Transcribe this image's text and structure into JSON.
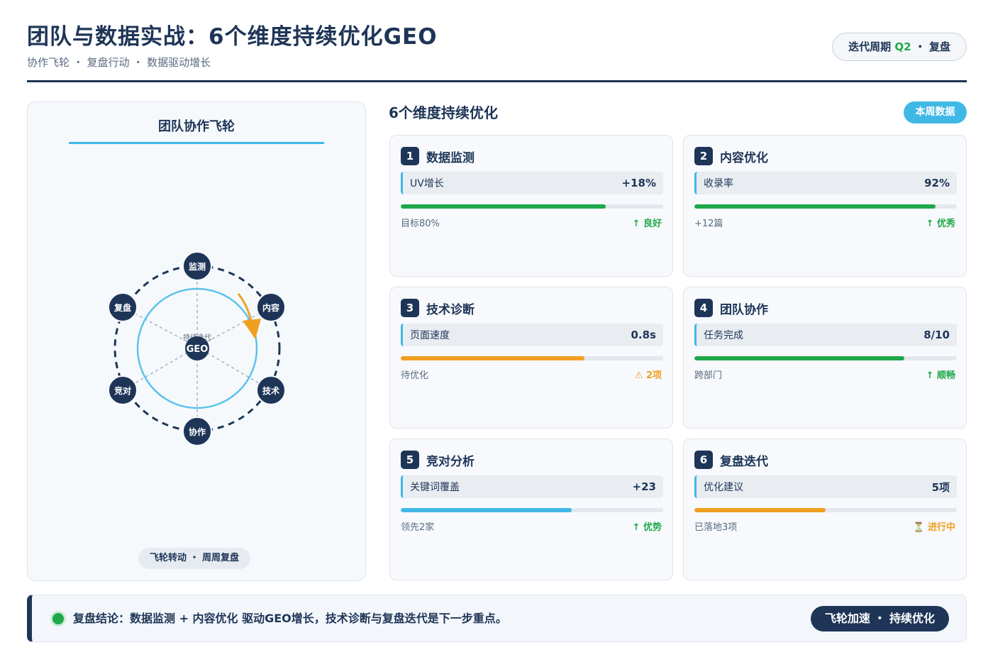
{
  "header": {
    "title": "团队与数据实战：6个维度持续优化GEO",
    "subtitle": "协作飞轮 ・ 复盘行动 ・ 数据驱动增长",
    "cycle_prefix": "迭代周期",
    "cycle_quarter": "Q2",
    "cycle_suffix": "・ 复盘"
  },
  "flywheel": {
    "title": "团队协作飞轮",
    "center_label": "GEO",
    "center_caption": "持续迭代",
    "nodes": [
      "监测",
      "内容",
      "技术",
      "协作",
      "竞对",
      "复盘"
    ],
    "footer": "飞轮转动 ・ 周周复盘"
  },
  "section": {
    "title": "6个维度持续优化",
    "badge": "本周数据"
  },
  "cards": [
    {
      "num": "1",
      "name": "数据监测",
      "metric_label": "UV增长",
      "metric_value": "+18%",
      "progress": 0.78,
      "bar_color": "#1ea84a",
      "foot_left": "目标80%",
      "foot_right": "↑ 良好",
      "status": "good"
    },
    {
      "num": "2",
      "name": "内容优化",
      "metric_label": "收录率",
      "metric_value": "92%",
      "progress": 0.92,
      "bar_color": "#1ea84a",
      "foot_left": "+12篇",
      "foot_right": "↑ 优秀",
      "status": "good"
    },
    {
      "num": "3",
      "name": "技术诊断",
      "metric_label": "页面速度",
      "metric_value": "0.8s",
      "progress": 0.7,
      "bar_color": "#f0a020",
      "foot_left": "待优化",
      "foot_right": "⚠ 2项",
      "status": "warn"
    },
    {
      "num": "4",
      "name": "团队协作",
      "metric_label": "任务完成",
      "metric_value": "8/10",
      "progress": 0.8,
      "bar_color": "#1ea84a",
      "foot_left": "跨部门",
      "foot_right": "↑ 顺畅",
      "status": "good"
    },
    {
      "num": "5",
      "name": "竞对分析",
      "metric_label": "关键词覆盖",
      "metric_value": "+23",
      "progress": 0.65,
      "bar_color": "#3fb8e6",
      "foot_left": "领先2家",
      "foot_right": "↑ 优势",
      "status": "good"
    },
    {
      "num": "6",
      "name": "复盘迭代",
      "metric_label": "优化建议",
      "metric_value": "5项",
      "progress": 0.5,
      "bar_color": "#f0a020",
      "foot_left": "已落地3项",
      "foot_right": "⏳ 进行中",
      "status": "warn"
    }
  ],
  "bottom": {
    "conclusion": "复盘结论：数据监测 + 内容优化 驱动GEO增长，技术诊断与复盘迭代是下一步重点。",
    "button": "飞轮加速 ・ 持续优化"
  },
  "colors": {
    "navy": "#1e3557",
    "accent": "#3fb8e6",
    "good": "#1ea84a",
    "warn": "#f0a020"
  }
}
